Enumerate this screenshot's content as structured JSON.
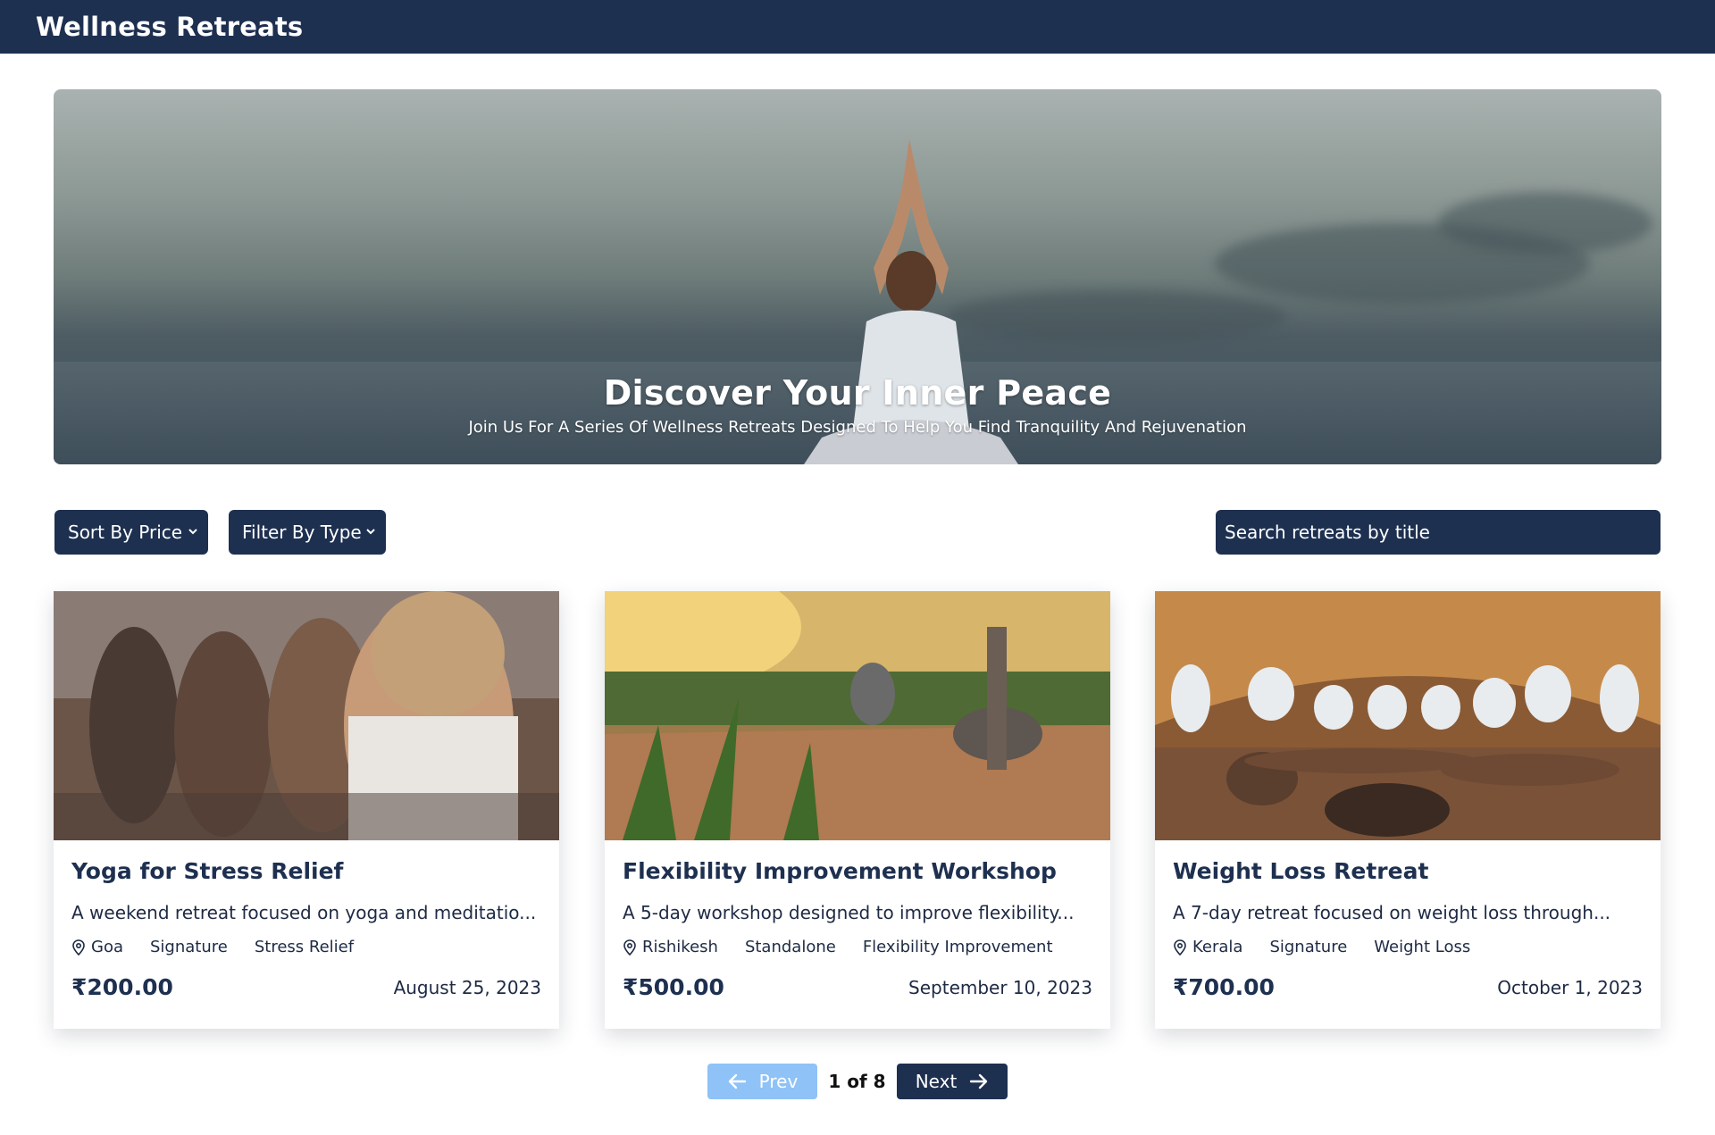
{
  "header": {
    "title": "Wellness Retreats"
  },
  "hero": {
    "title": "Discover Your Inner Peace",
    "subtitle": "Join Us For A Series Of Wellness Retreats Designed To Help You Find Tranquility And Rejuvenation"
  },
  "controls": {
    "sort_label": "Sort By Price",
    "filter_label": "Filter By Type",
    "search_placeholder": "Search retreats by title"
  },
  "retreats": [
    {
      "title": "Yoga for Stress Relief",
      "description": "A weekend retreat focused on yoga and meditatio...",
      "location": "Goa",
      "type": "Signature",
      "tag": "Stress Relief",
      "price": "₹200.00",
      "date": "August 25, 2023"
    },
    {
      "title": "Flexibility Improvement Workshop",
      "description": "A 5-day workshop designed to improve flexibility...",
      "location": "Rishikesh",
      "type": "Standalone",
      "tag": "Flexibility Improvement",
      "price": "₹500.00",
      "date": "September 10, 2023"
    },
    {
      "title": "Weight Loss Retreat",
      "description": "A 7-day retreat focused on weight loss through...",
      "location": "Kerala",
      "type": "Signature",
      "tag": "Weight Loss",
      "price": "₹700.00",
      "date": "October 1, 2023"
    }
  ],
  "pagination": {
    "prev_label": "Prev",
    "next_label": "Next",
    "indicator": "1 of 8"
  },
  "colors": {
    "primary": "#1e3050",
    "prev_disabled": "#8fc2f7"
  },
  "icons": [
    "location-pin-icon",
    "chevron-down-icon",
    "arrow-left-icon",
    "arrow-right-icon"
  ]
}
